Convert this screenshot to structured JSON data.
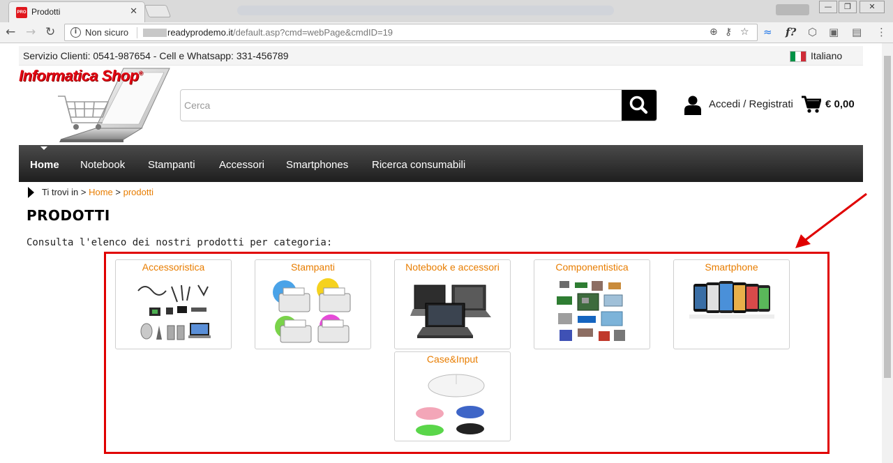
{
  "browser": {
    "tab_title": "Prodotti",
    "tab_favicon_text": "PRO",
    "tab_close": "✕",
    "window_buttons": {
      "minimize": "—",
      "restore": "❐",
      "close": "✕"
    },
    "security_label": "Non sicuro",
    "url_host": "readyprodemo.it",
    "url_path": "/default.asp?cmd=webPage&cmdID=19"
  },
  "header": {
    "service_text": "Servizio Clienti: 0541-987654 - Cell e Whatsapp: 331-456789",
    "language": "Italiano",
    "flag_colors": [
      "#009246",
      "#ffffff",
      "#ce2b37"
    ],
    "logo_text": "Informatica Shop",
    "logo_mark": "®",
    "search_placeholder": "Cerca",
    "login_label": "Accedi / Registrati",
    "cart_total": "€ 0,00"
  },
  "nav": {
    "items": [
      {
        "label": "Home",
        "active": true
      },
      {
        "label": "Notebook",
        "active": false
      },
      {
        "label": "Stampanti",
        "active": false
      },
      {
        "label": "Accessori",
        "active": false
      },
      {
        "label": "Smartphones",
        "active": false
      },
      {
        "label": "Ricerca consumabili",
        "active": false
      }
    ]
  },
  "breadcrumb": {
    "prefix": "Ti trovi in",
    "separator": ">",
    "home": "Home",
    "current": "prodotti"
  },
  "main": {
    "title": "PRODOTTI",
    "intro": "Consulta l'elenco dei nostri prodotti per categoria:"
  },
  "categories": [
    {
      "name": "Accessoristica",
      "icon": "accessories-image"
    },
    {
      "name": "Stampanti",
      "icon": "printers-image"
    },
    {
      "name": "Notebook e accessori",
      "icon": "notebooks-image"
    },
    {
      "name": "Componentistica",
      "icon": "components-image"
    },
    {
      "name": "Smartphone",
      "icon": "smartphones-image"
    },
    {
      "name": "Case&Input",
      "icon": "mouse-image"
    }
  ],
  "colors": {
    "accent_orange": "#e87d00",
    "highlight_red": "#e00000",
    "logo_red": "#e30613",
    "nav_dark": "#2a2a2a"
  }
}
